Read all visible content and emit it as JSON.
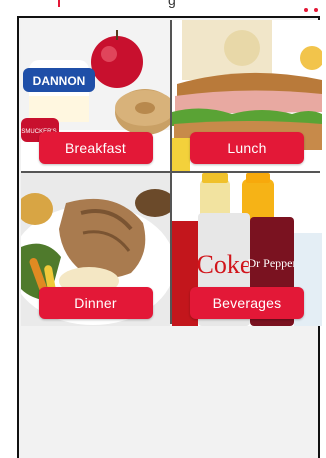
{
  "header": {
    "title_partial": "g"
  },
  "tiles": [
    {
      "label": "Breakfast"
    },
    {
      "label": "Lunch"
    },
    {
      "label": "Dinner"
    },
    {
      "label": "Beverages"
    }
  ],
  "colors": {
    "accent": "#e31837",
    "panel_bg": "#f2f2f2"
  },
  "food_text": {
    "yogurt_brand": "DANNON",
    "jam_brand": "SMUCKER'S",
    "drink_can_1": "Coke",
    "drink_can_2": "Dr Pepper"
  }
}
